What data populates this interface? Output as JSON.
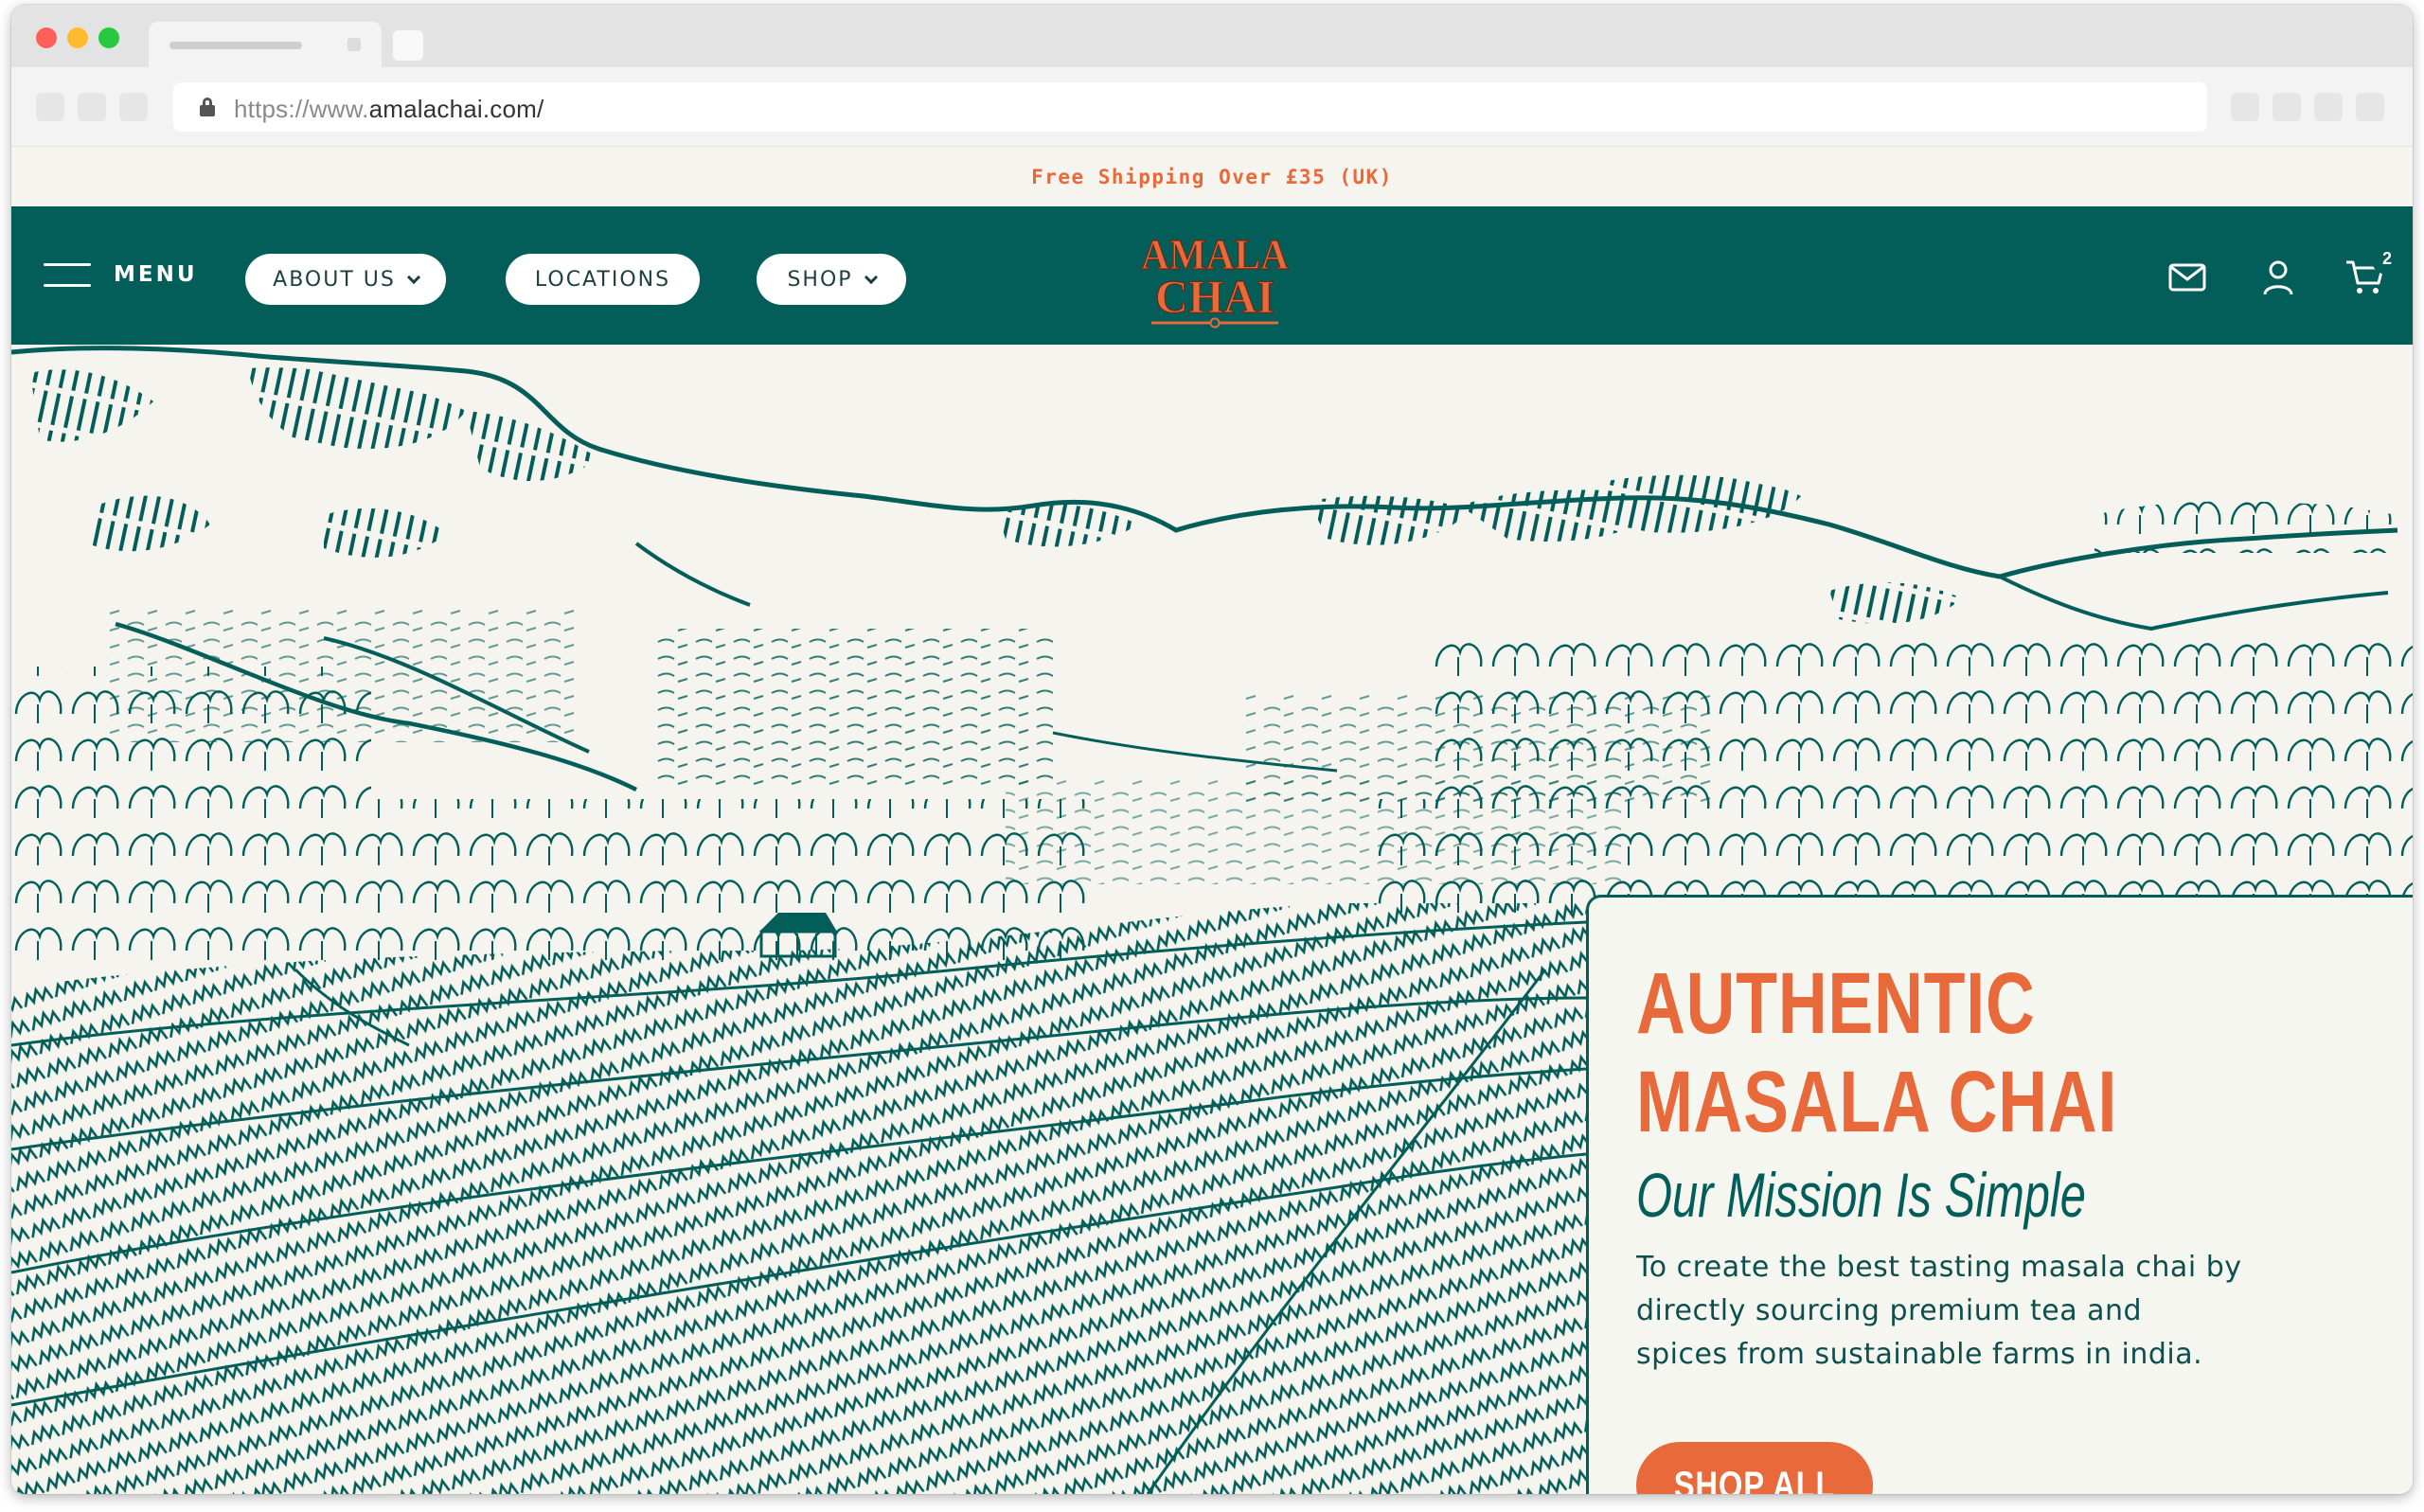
{
  "browser": {
    "url_prefix": "https://www.",
    "url_domain": "amalachai.com/"
  },
  "announcement": "Free Shipping Over £35 (UK)",
  "header": {
    "menu_label": "MENU",
    "nav": [
      {
        "label": "ABOUT US",
        "has_dropdown": true
      },
      {
        "label": "LOCATIONS",
        "has_dropdown": false
      },
      {
        "label": "SHOP",
        "has_dropdown": true
      }
    ],
    "logo_line1": "AMALA",
    "logo_line2": "CHAI",
    "icons": [
      "mail-icon",
      "user-icon",
      "cart-icon"
    ],
    "cart_count": "2"
  },
  "hero": {
    "title_line1": "AUTHENTIC",
    "title_line2": "MASALA CHAI",
    "subtitle": "Our Mission Is Simple",
    "body": "To create the best tasting masala chai by directly sourcing premium tea and spices from sustainable farms in india.",
    "cta_label": "SHOP ALL"
  },
  "colors": {
    "brand_teal": "#035e5a",
    "accent_orange": "#e8693a",
    "background_cream": "#f5f4ee"
  }
}
